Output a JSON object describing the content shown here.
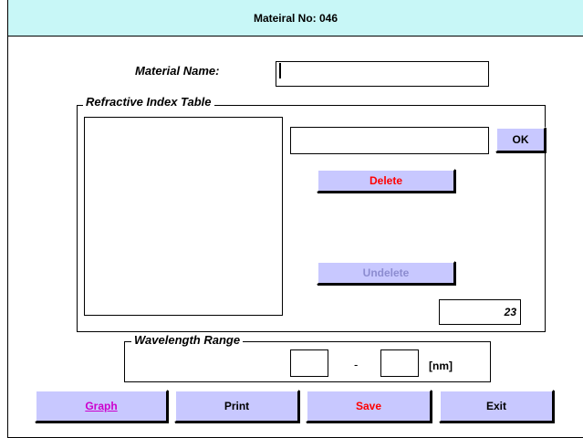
{
  "window": {
    "title": "Mateiral No: 046"
  },
  "material": {
    "label": "Material Name:",
    "value": ""
  },
  "refractive": {
    "legend": "Refractive Index Table",
    "entry_value": "",
    "ok_label": "OK",
    "delete_label": "Delete",
    "undelete_label": "Undelete",
    "count": "23"
  },
  "wavelength": {
    "legend": "Wavelength Range",
    "min_value": "",
    "separator": "-",
    "max_value": "",
    "unit": "[nm]"
  },
  "buttons": {
    "graph_label": "Graph",
    "print_label": "Print",
    "save_label": "Save",
    "exit_label": "Exit"
  },
  "colors": {
    "titlebar": "#c8f7f7",
    "button_face": "#c8c8ff",
    "delete_text": "#ff0000",
    "graph_text": "#cc00cc",
    "disabled_text": "#8c8cd0"
  }
}
